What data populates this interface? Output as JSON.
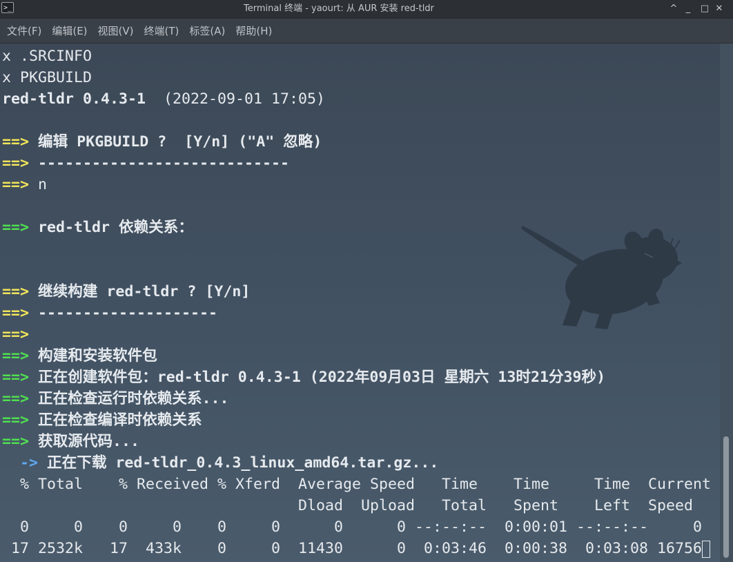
{
  "window": {
    "title": "Terminal 终端 - yaourt: 从 AUR 安装 red-tldr",
    "app_icon": "terminal-icon",
    "app_icon_glyph": ">_",
    "buttons": {
      "keep_above": "^",
      "minimize": "_",
      "maximize": "□",
      "close": "✕"
    }
  },
  "menu": [
    "文件(F)",
    "编辑(E)",
    "视图(V)",
    "终端(T)",
    "标签(A)",
    "帮助(H)"
  ],
  "colors": {
    "green_prompt": "#4fe04f",
    "yellow_prompt": "#f2e45a",
    "blue_arrow": "#5ea8f0",
    "text": "#e6eaee",
    "background": "#425263"
  },
  "terminal": {
    "lines": [
      [
        {
          "t": "x .SRCINFO",
          "s": "n"
        }
      ],
      [
        {
          "t": "x PKGBUILD",
          "s": "n"
        }
      ],
      [
        {
          "t": "red-tldr 0.4.3-1",
          "s": "b"
        },
        {
          "t": "  (2022-09-01 17:05)",
          "s": "n"
        }
      ],
      [],
      [
        {
          "t": "==>",
          "s": "y"
        },
        {
          "t": " 编辑 PKGBUILD ?  [Y/n] (\"A\" 忽略)",
          "s": "b"
        }
      ],
      [
        {
          "t": "==>",
          "s": "y"
        },
        {
          "t": " ----------------------------",
          "s": "b"
        }
      ],
      [
        {
          "t": "==>",
          "s": "y"
        },
        {
          "t": " n",
          "s": "n"
        }
      ],
      [],
      [
        {
          "t": "==>",
          "s": "g"
        },
        {
          "t": " red-tldr 依赖关系：",
          "s": "b"
        }
      ],
      [],
      [],
      [
        {
          "t": "==>",
          "s": "y"
        },
        {
          "t": " 继续构建 red-tldr ? [Y/n]",
          "s": "b"
        }
      ],
      [
        {
          "t": "==>",
          "s": "y"
        },
        {
          "t": " --------------------",
          "s": "b"
        }
      ],
      [
        {
          "t": "==>",
          "s": "y"
        }
      ],
      [
        {
          "t": "==>",
          "s": "g"
        },
        {
          "t": " 构建和安装软件包",
          "s": "b"
        }
      ],
      [
        {
          "t": "==>",
          "s": "g"
        },
        {
          "t": " 正在创建软件包：red-tldr 0.4.3-1 (2022年09月03日 星期六 13时21分39秒)",
          "s": "b"
        }
      ],
      [
        {
          "t": "==>",
          "s": "g"
        },
        {
          "t": " 正在检查运行时依赖关系...",
          "s": "b"
        }
      ],
      [
        {
          "t": "==>",
          "s": "g"
        },
        {
          "t": " 正在检查编译时依赖关系",
          "s": "b"
        }
      ],
      [
        {
          "t": "==>",
          "s": "g"
        },
        {
          "t": " 获取源代码...",
          "s": "b"
        }
      ],
      [
        {
          "t": "  ",
          "s": "n"
        },
        {
          "t": "->",
          "s": "c"
        },
        {
          "t": " 正在下载 red-tldr_0.4.3_linux_amd64.tar.gz...",
          "s": "b"
        }
      ],
      [
        {
          "t": "  % Total    % Received % Xferd  Average Speed   Time    Time     Time  Current",
          "s": "n"
        }
      ],
      [
        {
          "t": "                                 Dload  Upload   Total   Spent    Left  Speed",
          "s": "n"
        }
      ],
      [
        {
          "t": "  0     0    0     0    0     0      0      0 --:--:--  0:00:01 --:--:--     0",
          "s": "n"
        }
      ],
      [
        {
          "t": " 17 2532k   17  433k    0     0  11430      0  0:03:46  0:00:38  0:03:08 16756",
          "s": "n"
        }
      ]
    ],
    "cursor_after_last_line": true
  }
}
